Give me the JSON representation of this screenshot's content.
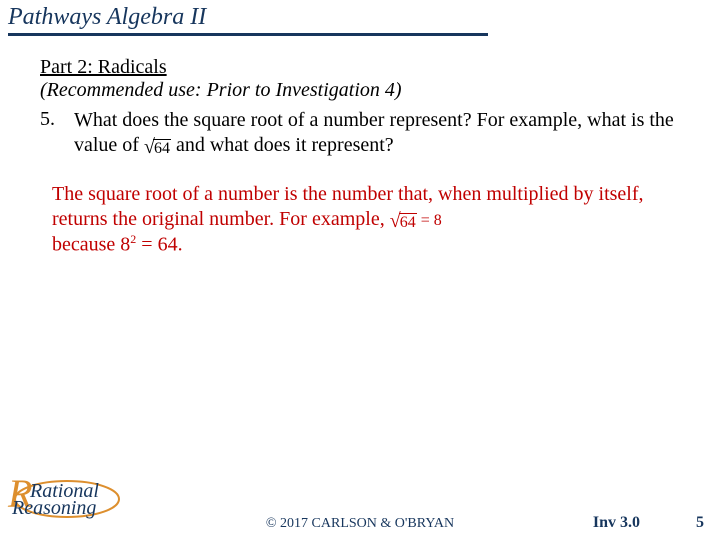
{
  "header": {
    "title": "Pathways Algebra II"
  },
  "part": {
    "label": "Part 2: Radicals",
    "recommended": "(Recommended use: Prior to Investigation 4)"
  },
  "question": {
    "number": "5.",
    "text_before_radical": "What does the square root of a number represent? For example, what is the value of ",
    "radicand": "64",
    "text_after_radical": " and what does it represent?"
  },
  "answer": {
    "line1_before": "The square root of a number is the number that, when multiplied by itself, returns the original number. For example, ",
    "radicand": "64",
    "equals": " = 8",
    "line2_before": "because 8",
    "exponent": "2",
    "line2_after": " = 64."
  },
  "footer": {
    "logo_line1": "Rational",
    "logo_line2": "Reasoning",
    "copyright": "© 2017 CARLSON & O'BRYAN",
    "inv": "Inv 3.0",
    "page": "5"
  }
}
